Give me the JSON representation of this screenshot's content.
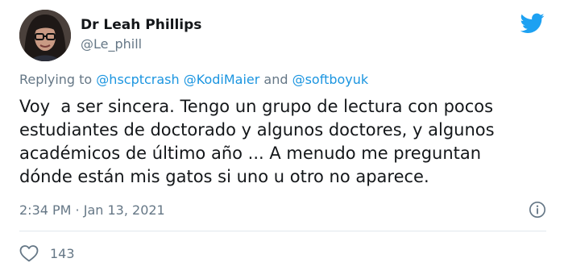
{
  "author": {
    "display_name": "Dr Leah Phillips",
    "handle": "@Le_phill"
  },
  "reply": {
    "prefix": "Replying to ",
    "mention_1": "@hscptcrash",
    "mention_2": "@KodiMaier",
    "conjunction": " and ",
    "mention_3": "@softboyuk"
  },
  "tweet": {
    "text": "Voy  a ser sincera. Tengo un grupo de lectura con pocos\nestudiantes de doctorado y algunos doctores, y algunos\nacadémicos de último año ... A menudo me preguntan\ndónde están mis gatos si uno u otro no aparece.",
    "timestamp": "2:34 PM · Jan 13, 2021",
    "like_count": "143"
  },
  "icons": {
    "brand": "twitter-bird-icon",
    "info": "info-icon",
    "like": "heart-icon"
  },
  "colors": {
    "brand_blue": "#1da1f2",
    "link_blue": "#1b95e0",
    "muted_text": "#657786",
    "divider": "#e1e8ed"
  }
}
